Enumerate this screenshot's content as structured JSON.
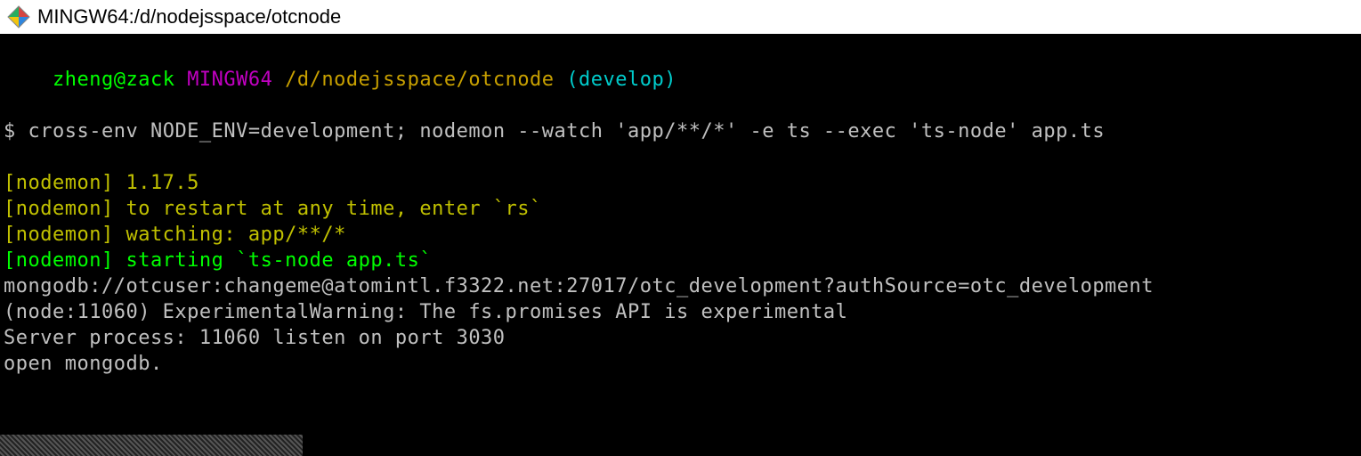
{
  "titleBar": {
    "title": "MINGW64:/d/nodejsspace/otcnode"
  },
  "prompt": {
    "user_host": "zheng@zack",
    "env": "MINGW64",
    "path": "/d/nodejsspace/otcnode",
    "branch": "(develop)",
    "symbol": "$",
    "command": "cross-env NODE_ENV=development; nodemon --watch 'app/**/*' -e ts --exec 'ts-node' app.ts"
  },
  "nodemon": {
    "version_line": "[nodemon] 1.17.5",
    "restart_line": "[nodemon] to restart at any time, enter `rs`",
    "watching_line": "[nodemon] watching: app/**/*",
    "starting_line": "[nodemon] starting `ts-node app.ts`"
  },
  "output": {
    "mongo_uri": "mongodb://otcuser:changeme@atomintl.f3322.net:27017/otc_development?authSource=otc_development",
    "experimental_warning": "(node:11060) ExperimentalWarning: The fs.promises API is experimental",
    "server_line": "Server process: 11060 listen on port 3030",
    "open_mongo": "open mongodb."
  }
}
